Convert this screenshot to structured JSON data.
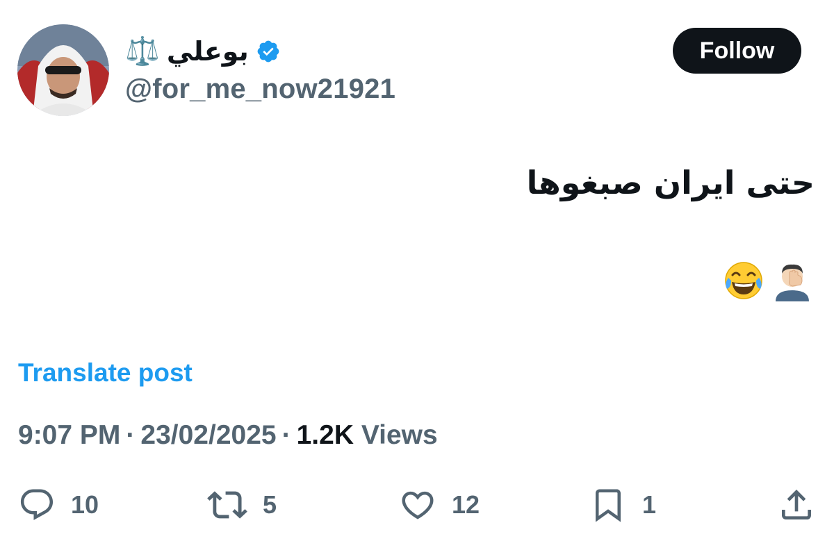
{
  "author": {
    "display_name": "بوعلي",
    "name_emoji": "⚖️",
    "handle": "@for_me_now21921",
    "verified": true,
    "verified_color": "#1d9bf0"
  },
  "follow_button": {
    "label": "Follow"
  },
  "post": {
    "text": "حتى ايران صبغوها",
    "emojis": [
      "man-facepalming-emoji",
      "face-with-tears-of-joy-emoji"
    ]
  },
  "translate": {
    "label": "Translate post"
  },
  "meta": {
    "time": "9:07 PM",
    "separator": "·",
    "date": "23/02/2025",
    "views_count": "1.2K",
    "views_label": "Views"
  },
  "actions": {
    "replies": "10",
    "reposts": "5",
    "likes": "12",
    "bookmarks": "1"
  },
  "colors": {
    "text_primary": "#0f1419",
    "text_secondary": "#536471",
    "link": "#1d9bf0",
    "button_bg": "#0f1419"
  }
}
